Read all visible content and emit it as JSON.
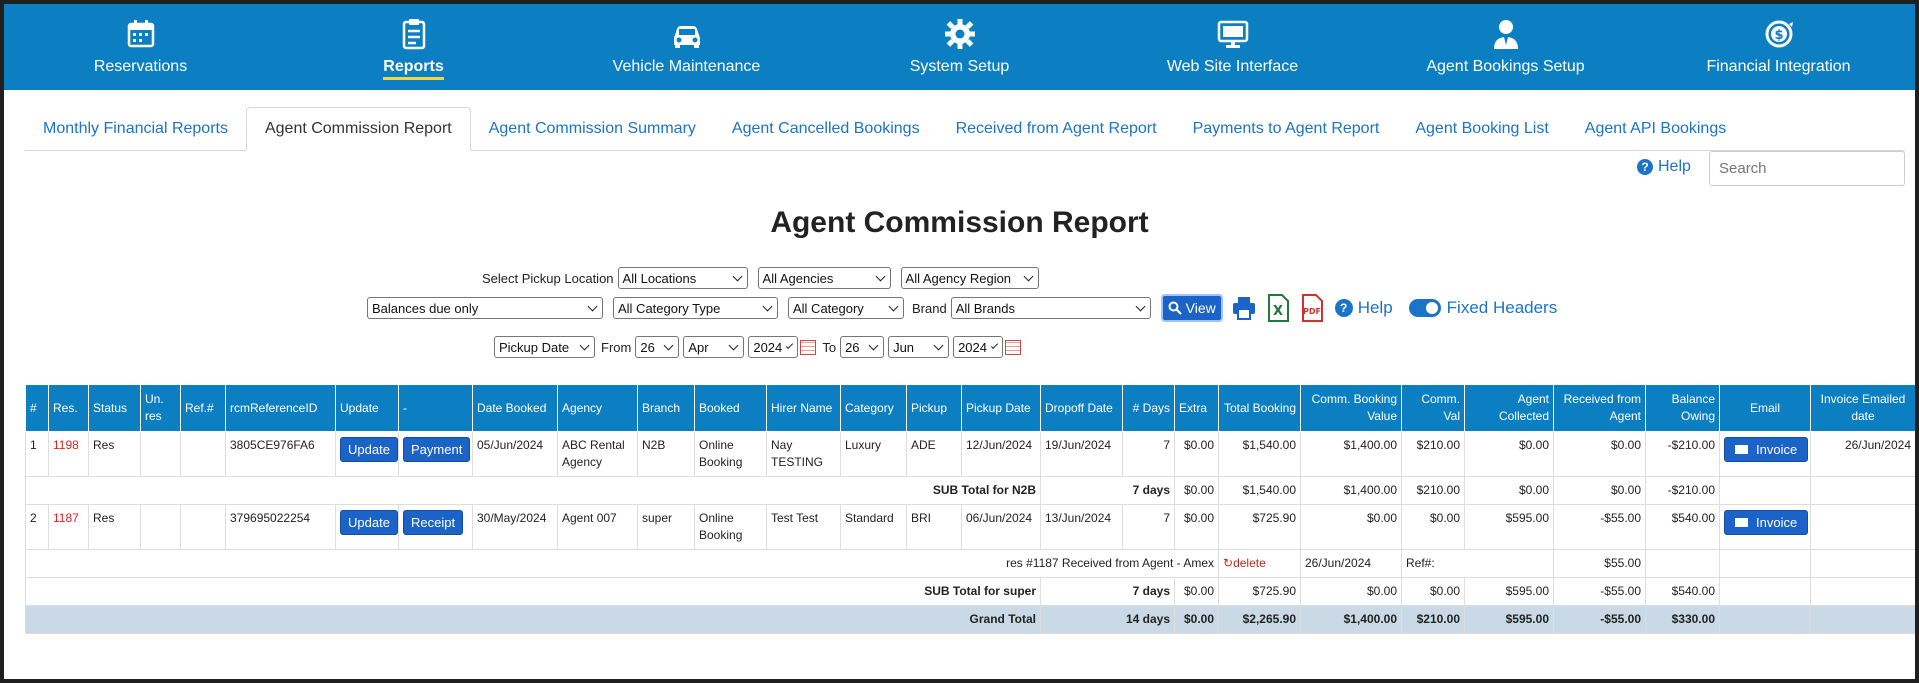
{
  "nav": [
    {
      "label": "Reservations",
      "icon": "calendar-icon"
    },
    {
      "label": "Reports",
      "icon": "clipboard-icon",
      "active": true
    },
    {
      "label": "Vehicle Maintenance",
      "icon": "car-icon"
    },
    {
      "label": "System Setup",
      "icon": "gear-icon"
    },
    {
      "label": "Web Site Interface",
      "icon": "monitor-icon"
    },
    {
      "label": "Agent Bookings Setup",
      "icon": "agent-icon"
    },
    {
      "label": "Financial Integration",
      "icon": "dollar-cycle-icon"
    }
  ],
  "tabs": [
    "Monthly Financial Reports",
    "Agent Commission Report",
    "Agent Commission Summary",
    "Agent Cancelled Bookings",
    "Received from Agent Report",
    "Payments to Agent Report",
    "Agent Booking List",
    "Agent API Bookings"
  ],
  "active_tab": 1,
  "help_label": "Help",
  "search": {
    "placeholder": "Search"
  },
  "title": "Agent Commission Report",
  "filters": {
    "pickup_location_label": "Select Pickup Location",
    "location": "All Locations",
    "agencies": "All Agencies",
    "agency_region": "All Agency Region",
    "balance": "Balances due only",
    "category_type": "All Category Type",
    "category": "All Category",
    "brand_label": "Brand",
    "brand": "All Brands",
    "view_label": "View",
    "help_label": "Help",
    "fixed_headers_label": "Fixed Headers",
    "date_type": "Pickup Date",
    "from_label": "From",
    "from_day": "26",
    "from_month": "Apr",
    "from_year": "2024",
    "to_label": "To",
    "to_day": "26",
    "to_month": "Jun",
    "to_year": "2024"
  },
  "columns": [
    "#",
    "Res.",
    "Status",
    "Un. res",
    "Ref.#",
    "rcmReferenceID",
    "Update",
    "-",
    "Date Booked",
    "Agency",
    "Branch",
    "Booked",
    "Hirer Name",
    "Category",
    "Pickup",
    "Pickup Date",
    "Dropoff Date",
    "# Days",
    "Extra",
    "Total Booking",
    "Comm. Booking Value",
    "Comm. Val",
    "Agent Collected",
    "Received from Agent",
    "Balance Owing",
    "Email",
    "Invoice Emailed date"
  ],
  "rows": [
    {
      "num": "1",
      "res": "1198",
      "status": "Res",
      "unres": "",
      "ref": "",
      "rcm": "3805CE976FA6",
      "update": "Update",
      "action": "Payment",
      "date_booked": "05/Jun/2024",
      "agency": "ABC Rental Agency",
      "branch": "N2B",
      "booked": "Online Booking",
      "hirer": "Nay TESTING",
      "category": "Luxury",
      "pickup": "ADE",
      "pickup_date": "12/Jun/2024",
      "dropoff_date": "19/Jun/2024",
      "days": "7",
      "extra": "$0.00",
      "total": "$1,540.00",
      "comm_value": "$1,400.00",
      "comm_val": "$210.00",
      "agent_collected": "$0.00",
      "received": "$0.00",
      "balance": "-$210.00",
      "email": "Invoice",
      "emailed_date": "26/Jun/2024"
    },
    {
      "num": "2",
      "res": "1187",
      "status": "Res",
      "unres": "",
      "ref": "",
      "rcm": "379695022254",
      "update": "Update",
      "action": "Receipt",
      "date_booked": "30/May/2024",
      "agency": "Agent 007",
      "branch": "super",
      "booked": "Online Booking",
      "hirer": "Test Test",
      "category": "Standard",
      "pickup": "BRI",
      "pickup_date": "06/Jun/2024",
      "dropoff_date": "13/Jun/2024",
      "days": "7",
      "extra": "$0.00",
      "total": "$725.90",
      "comm_value": "$0.00",
      "comm_val": "$0.00",
      "agent_collected": "$595.00",
      "received": "-$55.00",
      "balance": "$540.00",
      "email": "Invoice",
      "emailed_date": ""
    }
  ],
  "subtotals": [
    {
      "label": "SUB Total for N2B",
      "days": "7 days",
      "extra": "$0.00",
      "total": "$1,540.00",
      "comm_value": "$1,400.00",
      "comm_val": "$210.00",
      "agent_collected": "$0.00",
      "received": "$0.00",
      "balance": "-$210.00"
    },
    {
      "label": "SUB Total for super",
      "days": "7 days",
      "extra": "$0.00",
      "total": "$725.90",
      "comm_value": "$0.00",
      "comm_val": "$0.00",
      "agent_collected": "$595.00",
      "received": "-$55.00",
      "balance": "$540.00"
    }
  ],
  "payment": {
    "label": "res #1187 Received from Agent - Amex",
    "delete": "delete",
    "date": "26/Jun/2024",
    "ref": "Ref#:",
    "amount": "$55.00"
  },
  "grand": {
    "label": "Grand Total",
    "days": "14 days",
    "extra": "$0.00",
    "total": "$2,265.90",
    "comm_value": "$1,400.00",
    "comm_val": "$210.00",
    "agent_collected": "$595.00",
    "received": "-$55.00",
    "balance": "$330.00"
  }
}
